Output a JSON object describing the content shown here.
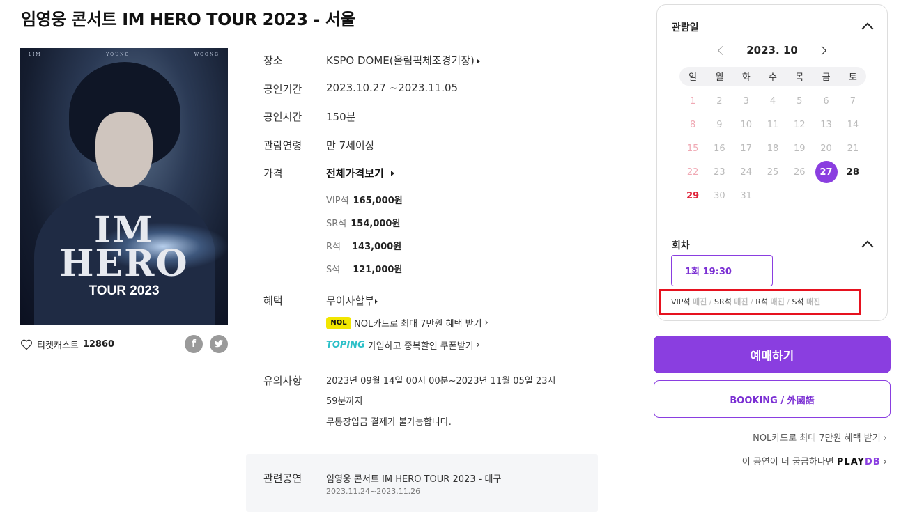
{
  "title": "임영웅 콘서트 IM HERO TOUR 2023 - 서울",
  "poster": {
    "top_text": [
      "LIM",
      "YOUNG",
      "WOONG"
    ],
    "logo_line1": "IM",
    "logo_line2": "HERO",
    "logo_sub": "TOUR 2023"
  },
  "likes": {
    "label": "티켓캐스트",
    "count": "12860"
  },
  "social": {
    "facebook": "f",
    "twitter": "t"
  },
  "info": {
    "venue_label": "장소",
    "venue": "KSPO DOME(올림픽체조경기장)",
    "period_label": "공연기간",
    "period": "2023.10.27 ~2023.11.05",
    "runtime_label": "공연시간",
    "runtime": "150분",
    "age_label": "관람연령",
    "age": "만 7세이상",
    "price_label": "가격",
    "price_all": "전체가격보기",
    "prices": [
      {
        "seat": "VIP석",
        "price": "165,000원"
      },
      {
        "seat": "SR석",
        "price": "154,000원"
      },
      {
        "seat": "R석",
        "price": "143,000원"
      },
      {
        "seat": "S석",
        "price": "121,000원"
      }
    ],
    "benefit_label": "혜택",
    "benefit_main": "무이자할부",
    "benefit_nol_badge": "NOL",
    "benefit_nol": "NOL카드로 최대 7만원 혜택 받기",
    "benefit_toping_badge": "TOPING",
    "benefit_toping": "가입하고 중복할인 쿠폰받기",
    "notice_label": "유의사항",
    "notice_lines": [
      "2023년 09월 14일 00시 00분~2023년 11월 05일 23시",
      "59분까지",
      "무통장입금 결제가 불가능합니다."
    ]
  },
  "related": {
    "label": "관련공연",
    "name": "임영웅 콘서트 IM HERO TOUR 2023 - 대구",
    "date": "2023.11.24~2023.11.26"
  },
  "calendar": {
    "heading": "관람일",
    "month": "2023. 10",
    "weekdays": [
      "일",
      "월",
      "화",
      "수",
      "목",
      "금",
      "토"
    ],
    "days": [
      "1",
      "2",
      "3",
      "4",
      "5",
      "6",
      "7",
      "8",
      "9",
      "10",
      "11",
      "12",
      "13",
      "14",
      "15",
      "16",
      "17",
      "18",
      "19",
      "20",
      "21",
      "22",
      "23",
      "24",
      "25",
      "26",
      "27",
      "28",
      "29",
      "30",
      "31"
    ],
    "selected_day": "27",
    "available_days": [
      "27",
      "28",
      "29"
    ]
  },
  "session": {
    "heading": "회차",
    "label": "1회 19:30",
    "seats": [
      {
        "seat": "VIP석",
        "status": "매진"
      },
      {
        "seat": "SR석",
        "status": "매진"
      },
      {
        "seat": "R석",
        "status": "매진"
      },
      {
        "seat": "S석",
        "status": "매진"
      }
    ]
  },
  "buttons": {
    "book": "예매하기",
    "booking_foreign": "BOOKING / 外國語"
  },
  "links": {
    "nol": "NOL카드로 최대 7만원 혜택 받기 ›",
    "playdb_text": "이 공연이 더 궁금하다면",
    "playdb_logo_a": "PLAY",
    "playdb_logo_b": "DB"
  },
  "colors": {
    "accent": "#8a3ee0",
    "highlight": "#e6121f",
    "sunday": "#e0243a"
  }
}
